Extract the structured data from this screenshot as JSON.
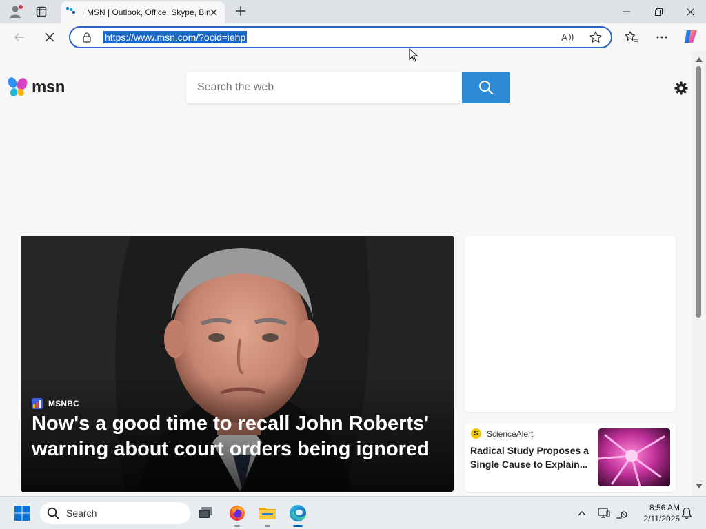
{
  "browser": {
    "tab": {
      "title": "MSN | Outlook, Office, Skype, Bing"
    },
    "address_bar": {
      "url": "https://www.msn.com/?ocid=iehp"
    }
  },
  "page": {
    "logo": {
      "text": "msn"
    },
    "search": {
      "placeholder": "Search the web"
    },
    "hero": {
      "source": "MSNBC",
      "headline": "Now's a good time to recall John Roberts' warning about court orders being ignored"
    },
    "news_card": {
      "source_badge": "S",
      "source": "ScienceAlert",
      "title": "Radical Study Proposes a Single Cause to Explain..."
    }
  },
  "taskbar": {
    "search_label": "Search",
    "clock": {
      "time": "8:56 AM",
      "date": "2/11/2025"
    }
  },
  "colors": {
    "accent": "#2b63c5",
    "search_button": "#2d8bd6",
    "url_selection": "#1a66c9"
  },
  "icons": [
    "profile-icon",
    "tab-actions-icon",
    "msn-favicon",
    "close-tab-icon",
    "new-tab-icon",
    "minimize-icon",
    "restore-icon",
    "close-window-icon",
    "back-icon",
    "stop-loading-icon",
    "lock-icon",
    "read-aloud-icon",
    "favorite-star-icon",
    "favorites-icon",
    "more-icon",
    "copilot-icon",
    "search-icon",
    "settings-gear-icon",
    "windows-start-icon",
    "task-view-icon",
    "firefox-icon",
    "file-explorer-icon",
    "edge-icon",
    "chevron-up-icon",
    "display-icon",
    "network-icon",
    "notification-bell-icon"
  ]
}
